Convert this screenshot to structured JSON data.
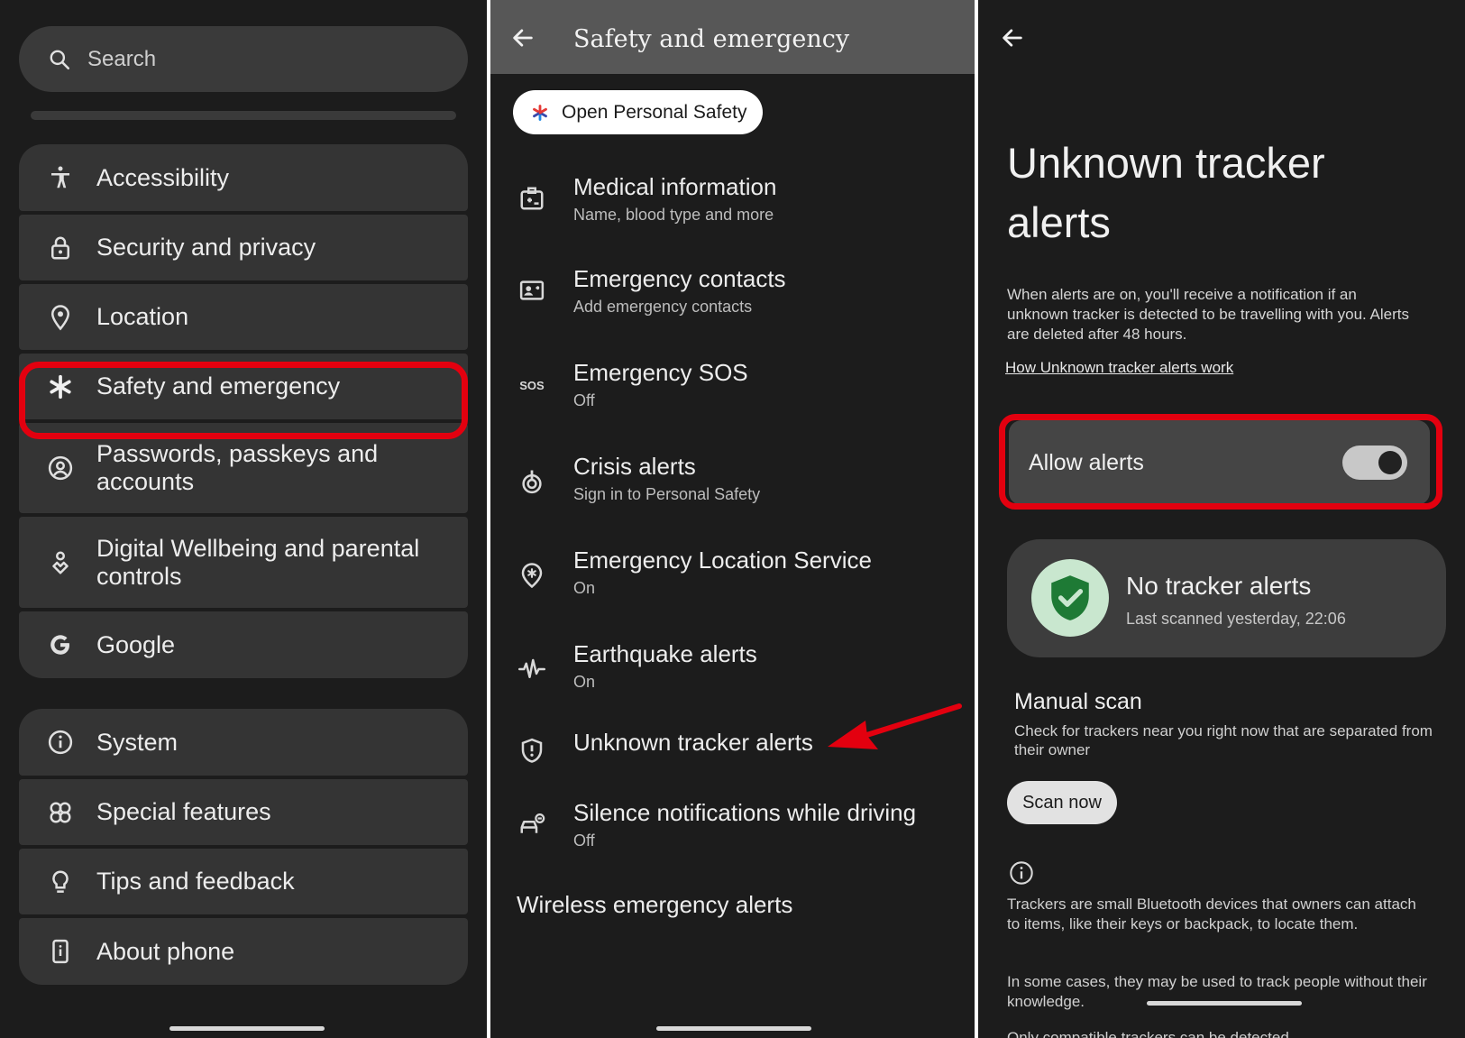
{
  "settings": {
    "search_placeholder": "Search",
    "group1": [
      {
        "label": "Accessibility",
        "icon": "accessibility-icon"
      },
      {
        "label": "Security and privacy",
        "icon": "lock-icon"
      },
      {
        "label": "Location",
        "icon": "location-pin-icon"
      },
      {
        "label": "Safety and emergency",
        "icon": "asterisk-icon",
        "highlighted": true
      },
      {
        "label": "Passwords, passkeys and accounts",
        "icon": "account-circle-icon"
      },
      {
        "label": "Digital Wellbeing and parental controls",
        "icon": "wellbeing-icon"
      },
      {
        "label": "Google",
        "icon": "google-g-icon"
      }
    ],
    "group2": [
      {
        "label": "System",
        "icon": "info-icon"
      },
      {
        "label": "Special features",
        "icon": "special-features-icon"
      },
      {
        "label": "Tips and feedback",
        "icon": "lightbulb-icon"
      },
      {
        "label": "About phone",
        "icon": "phone-icon"
      }
    ]
  },
  "safety": {
    "title": "Safety and emergency",
    "open_button": "Open Personal Safety",
    "items": [
      {
        "title": "Medical information",
        "subtitle": "Name, blood type and more",
        "icon": "medical-id-icon"
      },
      {
        "title": "Emergency contacts",
        "subtitle": "Add emergency contacts",
        "icon": "contact-card-icon"
      },
      {
        "title": "Emergency SOS",
        "subtitle": "Off",
        "icon": "sos-icon"
      },
      {
        "title": "Crisis alerts",
        "subtitle": "Sign in to Personal Safety",
        "icon": "crisis-alert-icon"
      },
      {
        "title": "Emergency Location Service",
        "subtitle": "On",
        "icon": "emergency-location-icon"
      },
      {
        "title": "Earthquake alerts",
        "subtitle": "On",
        "icon": "earthquake-icon"
      },
      {
        "title": "Unknown tracker alerts",
        "subtitle": "",
        "icon": "shield-alert-icon"
      },
      {
        "title": "Silence notifications while driving",
        "subtitle": "Off",
        "icon": "car-silence-icon"
      }
    ],
    "wireless": "Wireless emergency alerts"
  },
  "tracker": {
    "title_line1": "Unknown tracker",
    "title_line2": "alerts",
    "description": "When alerts are on, you'll receive a notification if an unknown tracker is detected to be travelling with you. Alerts are deleted after 48 hours.",
    "link": "How Unknown tracker alerts work",
    "allow_label": "Allow alerts",
    "allow_enabled": true,
    "status_title": "No tracker alerts",
    "status_sub": "Last scanned yesterday, 22:06",
    "manual_title": "Manual scan",
    "manual_desc": "Check for trackers near you right now that are separated from their owner",
    "scan_button": "Scan now",
    "info1": "Trackers are small Bluetooth devices that owners can attach to items, like their keys or backpack, to locate them.",
    "info2": "In some cases, they may be used to track people without their knowledge.",
    "info3": "Only compatible trackers can be detected."
  },
  "colors": {
    "highlight": "#e3000f",
    "shield_green": "#1e7a35",
    "shield_bg": "#c9e7cf"
  }
}
